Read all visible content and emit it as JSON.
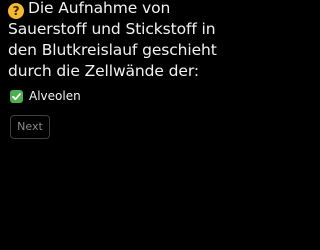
{
  "question": {
    "icon": "question-mark-icon",
    "icon_glyph": "?",
    "text": "Die Aufnahme von Sauerstoff und Stickstoff in den Blutkreislauf geschieht durch die Zellwände der:"
  },
  "answer": {
    "icon": "checkmark-icon",
    "label": "Alveolen"
  },
  "next_button": {
    "label": "Next"
  },
  "colors": {
    "background": "#000000",
    "text": "#f2f2f2",
    "question_icon": "#f5b82e",
    "check_icon": "#4caf50",
    "button_border": "#3d3d3d",
    "button_text": "#8a8a8a"
  }
}
